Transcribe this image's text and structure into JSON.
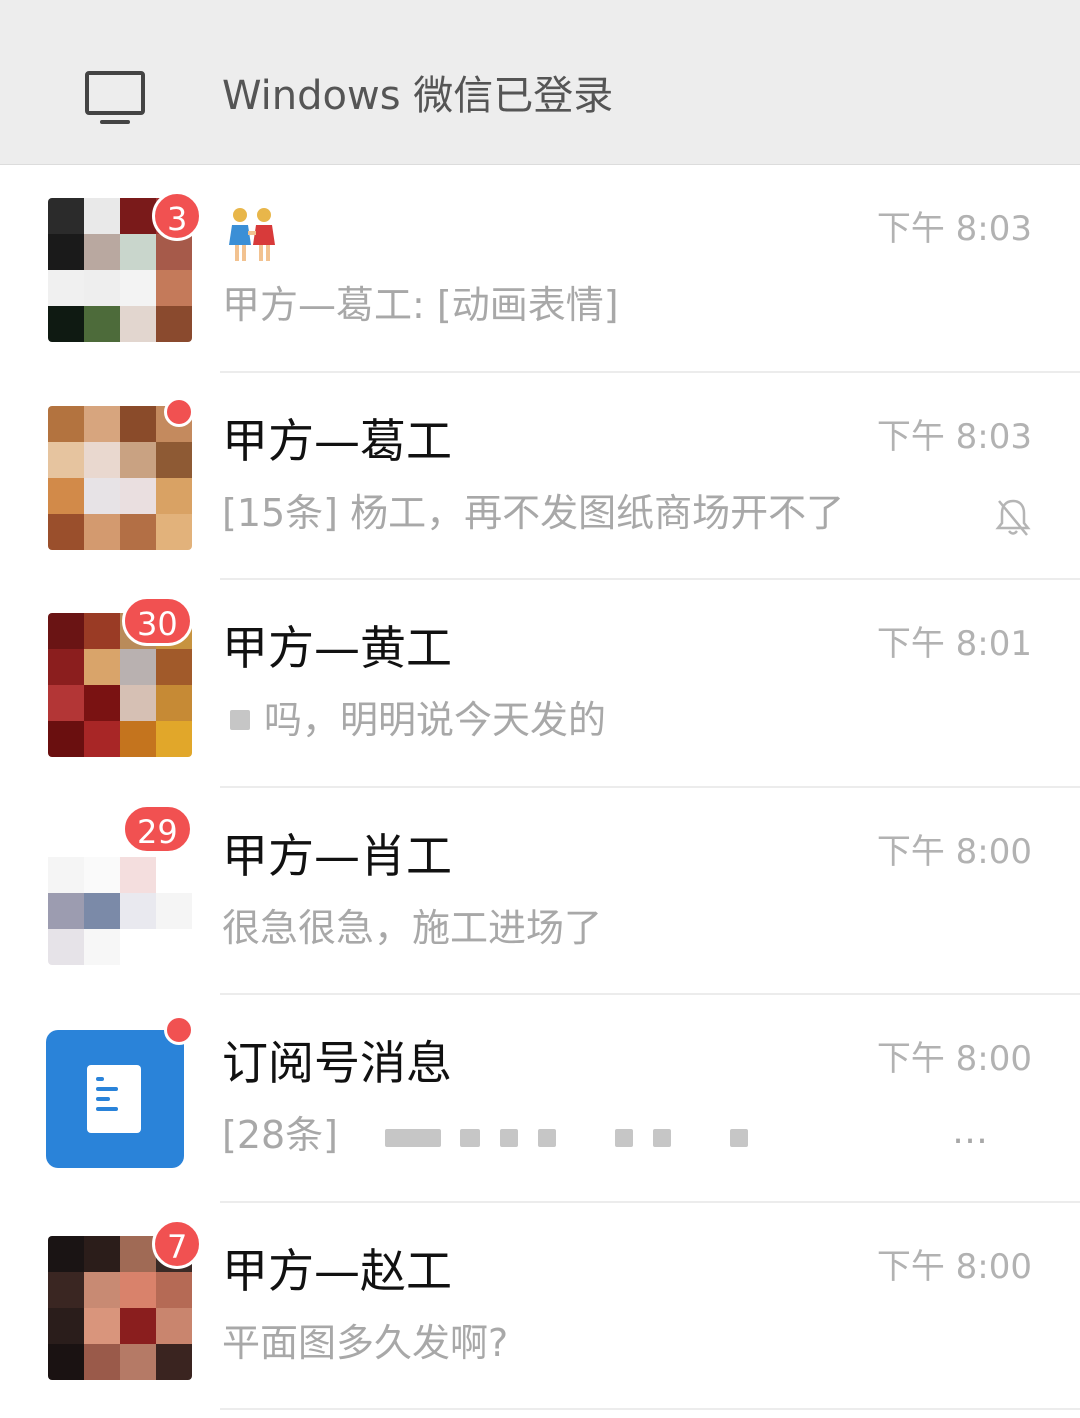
{
  "login_banner": {
    "text": "Windows 微信已登录",
    "icon": "monitor-icon"
  },
  "chats": [
    {
      "name": "",
      "name_emoji": "two-women-holding-hands",
      "time": "下午 8:03",
      "preview": "甲方—葛工: [动画表情]",
      "badge": "3",
      "muted": false
    },
    {
      "name": "甲方—葛工",
      "time": "下午 8:03",
      "preview": "[15条] 杨工，再不发图纸商场开不了",
      "badge": "",
      "red_dot": true,
      "muted": true
    },
    {
      "name": "甲方—黄工",
      "time": "下午 8:01",
      "preview": "吗，明明说今天发的",
      "badge": "30",
      "muted": false
    },
    {
      "name": "甲方—肖工",
      "time": "下午 8:00",
      "preview": "很急很急，施工进场了",
      "badge": "29",
      "muted": false
    },
    {
      "name": "订阅号消息",
      "time": "下午 8:00",
      "preview": "[28条]",
      "red_dot": true,
      "more": "…",
      "muted": false
    },
    {
      "name": "甲方—赵工",
      "time": "下午 8:00",
      "preview": "平面图多久发啊?",
      "badge": "7",
      "muted": false
    }
  ],
  "colors": {
    "badge": "#f15151",
    "subscription_avatar": "#2a83d9",
    "banner_bg": "#ededed",
    "time_text": "#b2b2b2",
    "preview_text": "#a8a8a8"
  }
}
